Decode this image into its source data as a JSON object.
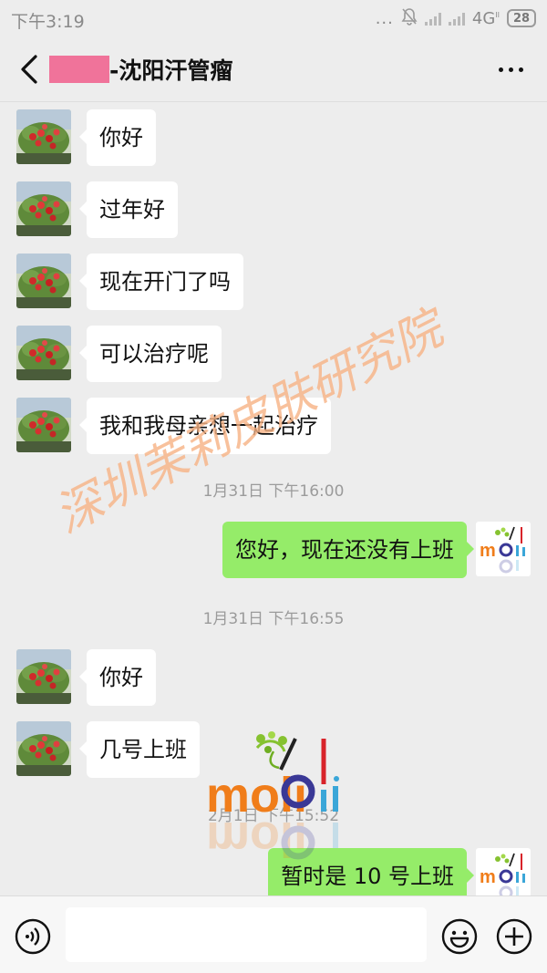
{
  "status": {
    "time": "下午3:19",
    "dots": "...",
    "network": "4G",
    "network_sup": "II",
    "battery": "28"
  },
  "header": {
    "title": "-沈阳汗管瘤",
    "back_icon": "chevron-left-icon",
    "more_icon": "more-dots-icon"
  },
  "messages": [
    {
      "side": "in",
      "text": "你好"
    },
    {
      "side": "in",
      "text": "过年好"
    },
    {
      "side": "in",
      "text": "现在开门了吗"
    },
    {
      "side": "in",
      "text": "可以治疗呢"
    },
    {
      "side": "in",
      "text": "我和我母亲想一起治疗"
    },
    {
      "type": "time",
      "text": "1月31日 下午16:00"
    },
    {
      "side": "out",
      "text": "您好，现在还没有上班"
    },
    {
      "type": "time",
      "text": "1月31日 下午16:55"
    },
    {
      "side": "in",
      "text": "你好"
    },
    {
      "side": "in",
      "text": "几号上班"
    },
    {
      "type": "time",
      "text": "2月1日 下午15:52"
    },
    {
      "side": "out",
      "text": "暂时是 10 号上班"
    }
  ],
  "watermark": {
    "text": "深圳茉莉皮肤研究院",
    "color": "#f6b183"
  },
  "logo": {
    "text": "moli"
  },
  "input": {
    "value": "",
    "voice_icon": "voice-icon",
    "emoji_icon": "emoji-icon",
    "plus_icon": "plus-icon"
  },
  "colors": {
    "incoming_bubble": "#ffffff",
    "outgoing_bubble": "#95ec69",
    "background": "#ededed",
    "name_mask": "#f0739a"
  }
}
